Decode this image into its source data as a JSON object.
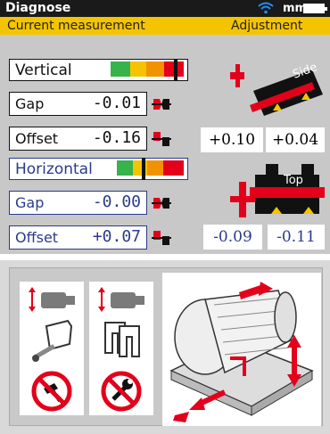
{
  "topbar": {
    "title": "Diagnose",
    "unit": "mm",
    "wifi_icon": "wifi-icon",
    "battery_icon": "battery-icon"
  },
  "tabs": {
    "left": "Current measurement",
    "right": "Adjustment"
  },
  "vertical": {
    "label": "Vertical",
    "gap": {
      "label": "Gap",
      "value": "-0.01"
    },
    "offset": {
      "label": "Offset",
      "value": "-0.16"
    },
    "side_label": "Side",
    "adjust": [
      "+0.10",
      "+0.04"
    ]
  },
  "horizontal": {
    "label": "Horizontal",
    "gap": {
      "label": "Gap",
      "value": "-0.00"
    },
    "offset": {
      "label": "Offset",
      "value": "+0.07"
    },
    "top_label": "Top",
    "adjust": [
      "-0.09",
      "-0.11"
    ]
  },
  "colors": {
    "green": "#36b34a",
    "yellow": "#f5c400",
    "orange": "#f39200",
    "red": "#e3001b",
    "blue": "#2a3a8c",
    "yellow_bar": "#f5c400"
  }
}
